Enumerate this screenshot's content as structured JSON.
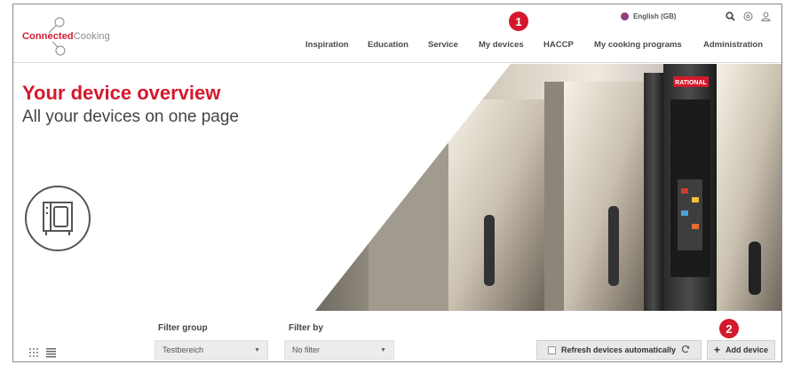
{
  "header": {
    "logo": {
      "part1": "Connected",
      "part2": "Cooking"
    },
    "language": "English (GB)",
    "icons": [
      "search-icon",
      "settings-icon",
      "user-icon"
    ],
    "nav": [
      {
        "label": "Inspiration"
      },
      {
        "label": "Education"
      },
      {
        "label": "Service"
      },
      {
        "label": "My devices"
      },
      {
        "label": "HACCP"
      },
      {
        "label": "My cooking programs"
      },
      {
        "label": "Administration"
      }
    ]
  },
  "markers": {
    "one": "1",
    "two": "2"
  },
  "hero": {
    "title": "Your device overview",
    "subtitle": "All your devices on one page",
    "badge": "RATIONAL"
  },
  "filters": {
    "group_label": "Filter group",
    "group_value": "Testbereich",
    "by_label": "Filter by",
    "by_value": "No filter",
    "refresh_label": "Refresh devices automatically",
    "add_label": "Add device"
  },
  "colors": {
    "brand_red": "#d4192c",
    "text_dark": "#444444",
    "button_grey": "#e8e8e8"
  }
}
